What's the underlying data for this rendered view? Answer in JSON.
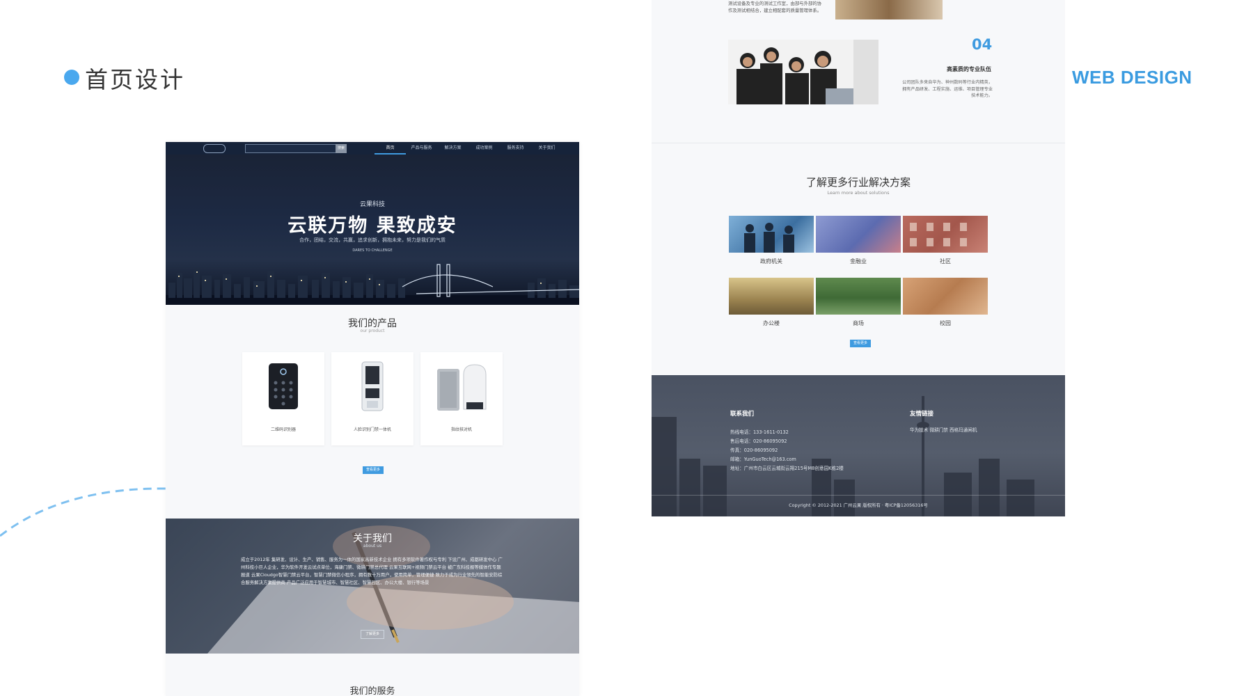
{
  "slide": {
    "title": "首页设计",
    "tag": "WEB DESIGN",
    "accent": "#3f9be0"
  },
  "homepage": {
    "nav": {
      "items": [
        "首页",
        "产品与服务",
        "解决方案",
        "成功案例",
        "服务支持",
        "关于我们"
      ],
      "active": "首页",
      "search_button": "搜索"
    },
    "hero": {
      "subtitle": "云果科技",
      "title": "云联万物 果致成安",
      "slogan": "合作，团结，交流，共赢，追求创新，拥抱未来，努力是我们的气质",
      "english": "DARES TO CHALLENGE"
    },
    "products": {
      "title": "我们的产品",
      "subtitle": "our product",
      "items": [
        {
          "name": "二维码识别器",
          "icon": "keypad-reader-icon"
        },
        {
          "name": "人脸识别门禁一体机",
          "icon": "face-terminal-icon"
        },
        {
          "name": "指纹核对机",
          "icon": "fingerprint-device-icon"
        }
      ],
      "more_button": "查看更多"
    },
    "about": {
      "title": "关于我们",
      "subtitle": "about us",
      "body": "成立于2012年 集研发、设计、生产、销售、服务为一体的国家高新技术企业 拥有多项软件著作权与专利 下设广州、成都研发中心 广州科技小巨人企业，华为软件开发云试点单位，海康门禁、微耕门禁总代理 云果互联网+视频门禁云平台 被广东科技报等媒体作专题报道 云果Cloudgo智慧门禁云平台，智慧门禁微信小程序，拥有数十万用户，使用简单，管理便捷 致力于成为行业领先的智能安防综合服务解决方案提供商 产品广泛应用于智慧城市、智慧社区、智慧园区、办公大楼、银行等场景",
      "button": "了解更多"
    },
    "services": {
      "title": "我们的服务"
    }
  },
  "solutions_page": {
    "top_text": "测试设备及专业的测试工作室，由部与外部的协作及测试相结合，建立相配套的质量管理体系。",
    "team": {
      "number": "04",
      "title": "高素质的专业队伍",
      "desc": "公司团队多来自华为、神州数码等行业内精英，拥有产品研发、工程实施、运维、项目管理专业技术能力。"
    },
    "solutions": {
      "title": "了解更多行业解决方案",
      "subtitle": "Learn more about solutions",
      "items": [
        "政府机关",
        "金融业",
        "社区",
        "办公楼",
        "商场",
        "校园"
      ],
      "more_button": "查看更多"
    },
    "footer": {
      "contact_title": "联系我们",
      "contact_lines": [
        "热线电话：133-1611-0132",
        "售后电话：020-86095092",
        "传真：020-86095092",
        "邮箱：YunGuoTech@163.com",
        "地址：广州市白云区云城街云翔215号M8创意园K栋2楼"
      ],
      "links_title": "友情链接",
      "links": "华为技术 微耕门禁 西格玛通闸机",
      "copyright": "Copyright © 2012-2021 广州云果 版权所有 · 粤ICP备12056316号"
    }
  }
}
